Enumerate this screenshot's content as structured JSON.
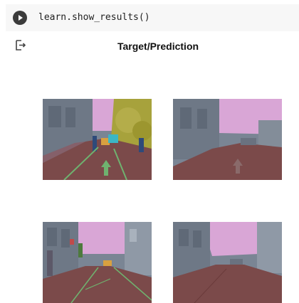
{
  "cell": {
    "code": "learn.show_results()",
    "run_icon": "play-icon"
  },
  "output": {
    "icon": "output-icon",
    "title": "Target/Prediction"
  },
  "images": [
    {
      "name": "target-image-1",
      "description": "street scene target"
    },
    {
      "name": "prediction-image-1",
      "description": "street scene prediction"
    },
    {
      "name": "target-image-2",
      "description": "street scene target"
    },
    {
      "name": "prediction-image-2",
      "description": "street scene prediction"
    }
  ],
  "colors": {
    "sky": "#d9a6d6",
    "road": "#7b4a4a",
    "building": "#7a8594",
    "tree": "#a7a23c",
    "lane": "#6fb26f"
  }
}
